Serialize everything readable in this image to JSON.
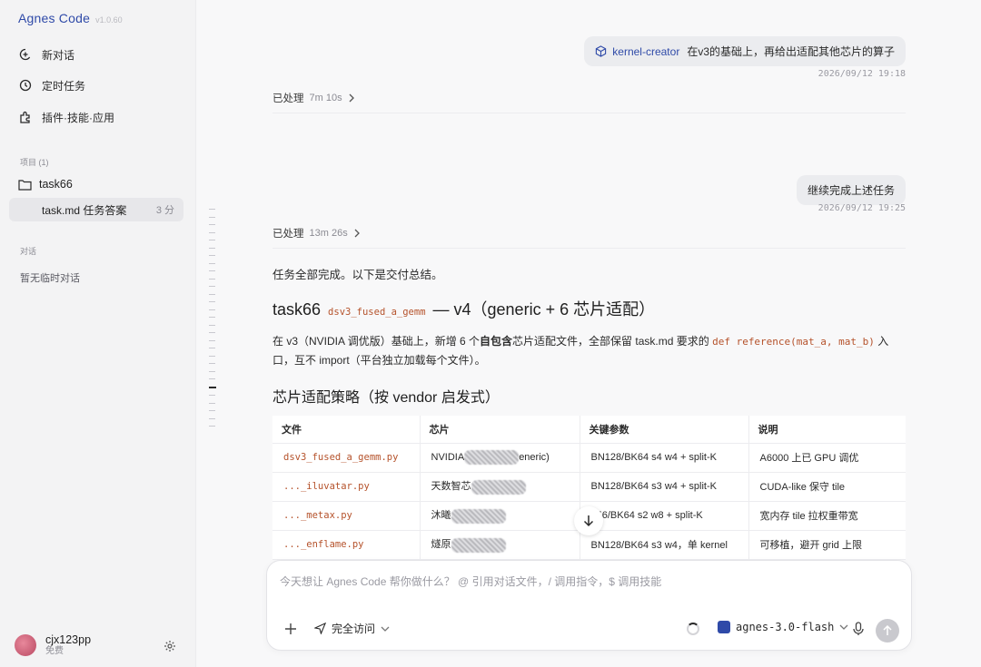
{
  "app": {
    "name": "Agnes Code",
    "version": "v1.0.60"
  },
  "sidebar": {
    "nav": [
      {
        "label": "新对话",
        "icon": "new-chat-icon"
      },
      {
        "label": "定时任务",
        "icon": "clock-icon"
      },
      {
        "label": "插件·技能·应用",
        "icon": "plugin-icon"
      }
    ],
    "projects_label": "项目 (1)",
    "project": {
      "name": "task66",
      "item": "task.md 任务答案",
      "item_age": "3 分"
    },
    "chats_label": "对话",
    "empty_chats": "暂无临时对话",
    "user": {
      "name": "cjx123pp",
      "plan": "免费"
    }
  },
  "conversation": {
    "msg1": {
      "mention": "kernel-creator",
      "text": "在v3的基础上，再给出适配其他芯片的算子",
      "time": "2026/09/12 19:18"
    },
    "processed1": {
      "label": "已处理",
      "duration": "7m 10s"
    },
    "msg2": {
      "text": "继续完成上述任务",
      "time": "2026/09/12 19:25"
    },
    "processed2": {
      "label": "已处理",
      "duration": "13m 26s"
    },
    "answer": {
      "intro": "任务全部完成。以下是交付总结。",
      "h1_prefix": "task66",
      "h1_code": "dsv3_fused_a_gemm",
      "h1_suffix": "— v4（generic + 6 芯片适配）",
      "para_a": "在 v3（NVIDIA 调优版）基础上，新增 6 个",
      "para_bold": "自包含",
      "para_b": "芯片适配文件，全部保留 task.md 要求的",
      "para_code": "def reference(mat_a, mat_b)",
      "para_c": "入口，互不 import（平台独立加载每个文件）。",
      "h2": "芯片适配策略（按 vendor 启发式）"
    },
    "table": {
      "headers": [
        "文件",
        "芯片",
        "关键参数",
        "说明"
      ],
      "rows": [
        {
          "file": "dsv3_fused_a_gemm.py",
          "chip_a": "NVIDIA",
          "chip_b": "eneric)",
          "params": "BN128/BK64 s4 w4 + split-K",
          "note": "A6000 上已 GPU 调优"
        },
        {
          "file": "..._iluvatar.py",
          "chip_a": "天数智芯",
          "chip_b": "",
          "params": "BN128/BK64 s3 w4 + split-K",
          "note": "CUDA-like 保守 tile"
        },
        {
          "file": "..._metax.py",
          "chip_a": "沐曦",
          "chip_b": "",
          "params": "256/BK64 s2 w8 + split-K",
          "note": "宽内存 tile 拉权重带宽"
        },
        {
          "file": "..._enflame.py",
          "chip_a": "燧原",
          "chip_b": "",
          "params": "BN128/BK64 s3 w4，单 kernel",
          "note": "可移植，避开 grid 上限"
        }
      ]
    }
  },
  "composer": {
    "placeholder": "今天想让 Agnes Code 帮你做什么？ @ 引用对话文件，/ 调用指令，$ 调用技能",
    "access": "完全访问",
    "model": "agnes-3.0-flash"
  }
}
